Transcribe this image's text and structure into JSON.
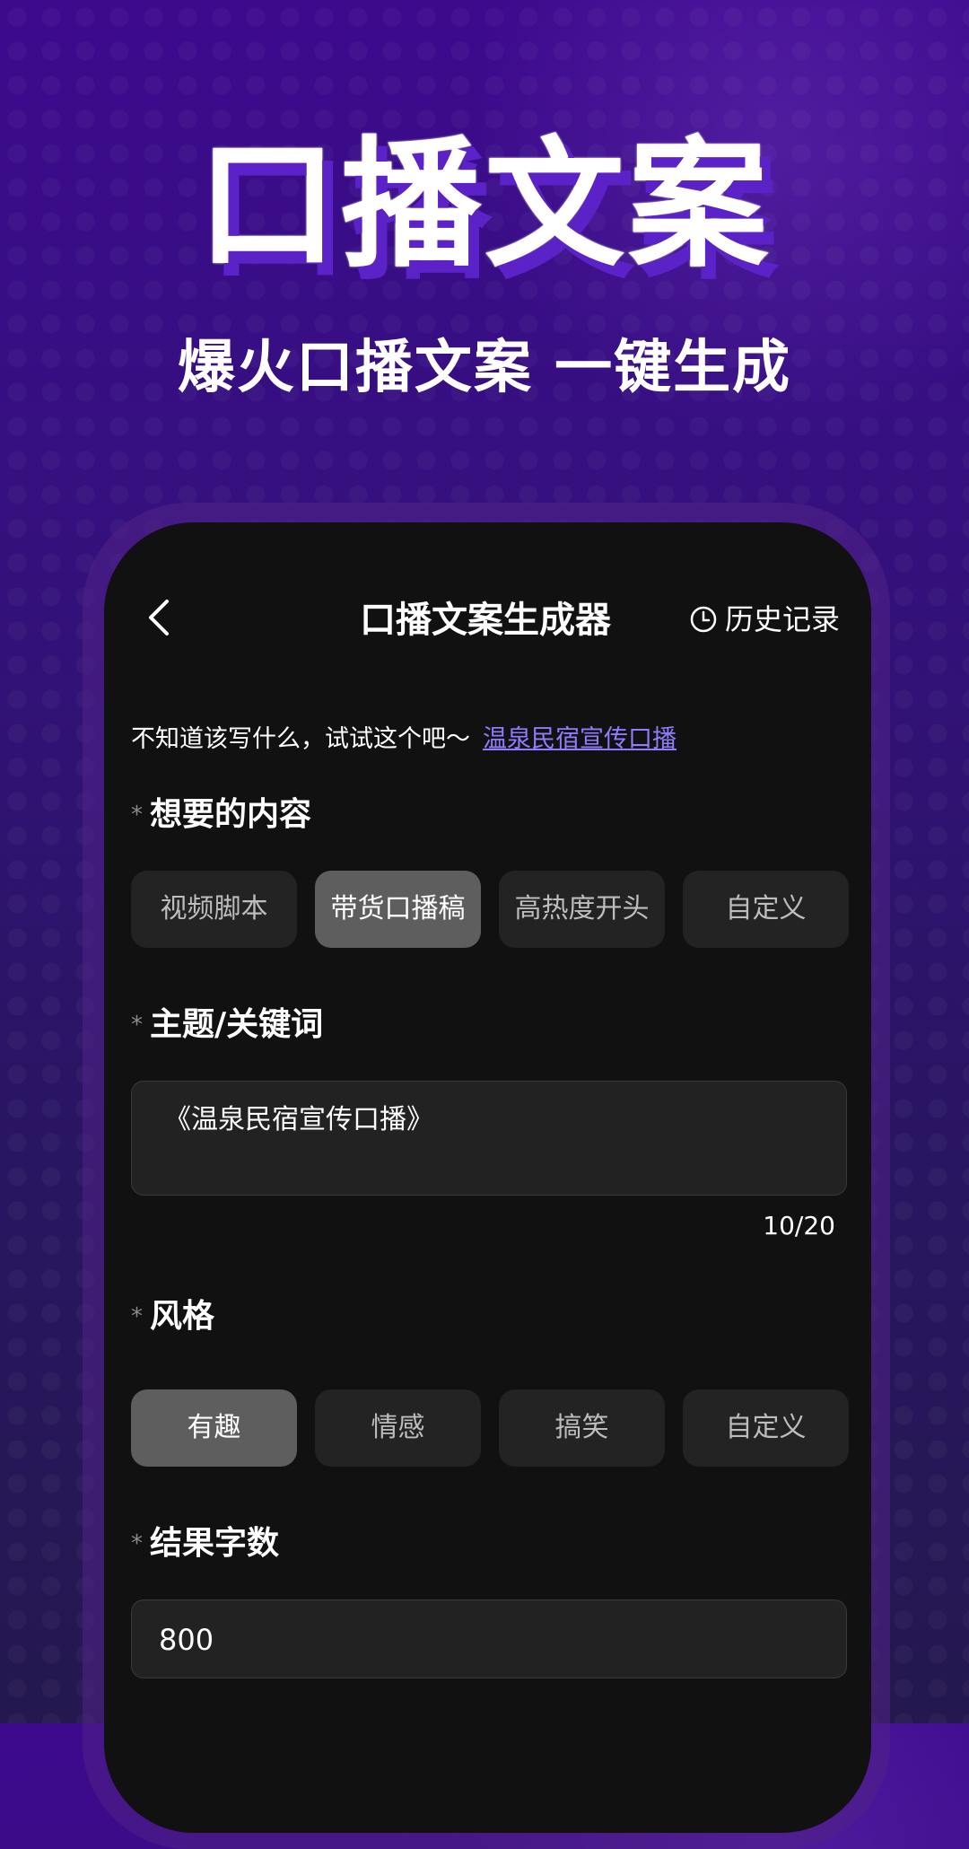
{
  "hero": {
    "title": "口播文案",
    "subtitle": "爆火口播文案 一键生成"
  },
  "header": {
    "title": "口播文案生成器",
    "history_label": "历史记录",
    "back_icon": "chevron-left-icon",
    "history_icon": "clock-icon"
  },
  "suggestion": {
    "prompt": "不知道该写什么，试试这个吧～",
    "link": "温泉民宿宣传口播"
  },
  "content_section": {
    "required_mark": "*",
    "label": "想要的内容",
    "options": [
      "视频脚本",
      "带货口播稿",
      "高热度开头",
      "自定义"
    ],
    "selected_index": 1
  },
  "topic_section": {
    "required_mark": "*",
    "label": "主题/关键词",
    "value": "《温泉民宿宣传口播》",
    "count": "10/20"
  },
  "style_section": {
    "required_mark": "*",
    "label": "风格",
    "options": [
      "有趣",
      "情感",
      "搞笑",
      "自定义"
    ],
    "selected_index": 0
  },
  "wordcount_section": {
    "required_mark": "*",
    "label": "结果字数",
    "value": "800"
  },
  "colors": {
    "background_top": "#3d0a8e",
    "background_bottom": "#24184f",
    "accent_link": "#8f7cff",
    "chip_selected": "#5e5e5e",
    "chip_default": "#232323",
    "screen_bg": "#111111"
  }
}
